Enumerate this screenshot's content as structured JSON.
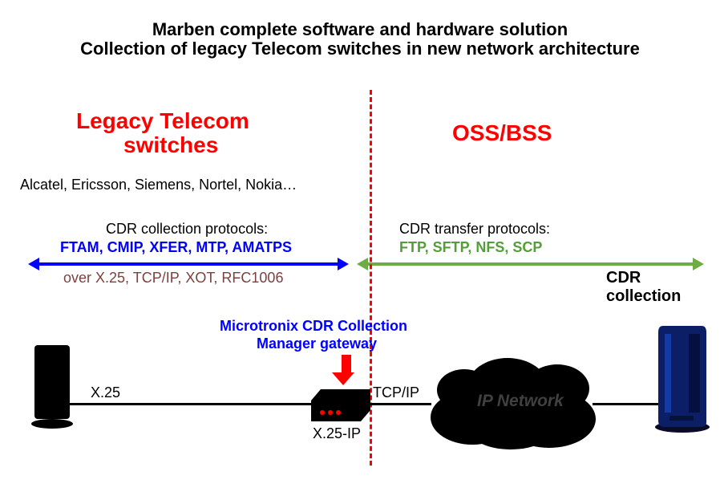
{
  "titles": {
    "line1": "Marben complete software and hardware solution",
    "line2": "Collection of legacy Telecom switches in new network architecture"
  },
  "left": {
    "header1": "Legacy Telecom",
    "header2": "switches",
    "vendors": "Alcatel, Ericsson, Siemens, Nortel, Nokia…",
    "collect_hdr": "CDR collection protocols:",
    "collect_proto": "FTAM, CMIP, XFER, MTP, AMATPS",
    "over": "over X.25, TCP/IP, XOT, RFC1006"
  },
  "right": {
    "header": "OSS/BSS",
    "transfer_hdr": "CDR transfer protocols:",
    "transfer_proto": "FTP, SFTP, NFS, SCP",
    "cdr_label1": "CDR",
    "cdr_label2": "collection"
  },
  "gateway": {
    "label1": "Microtronix CDR Collection",
    "label2": "Manager gateway",
    "caption": "X.25-IP"
  },
  "net": {
    "link1": "X.25",
    "link2": "TCP/IP",
    "cloud": "IP Network"
  },
  "icons": {
    "switch": "switch-icon",
    "gateway": "router-icon",
    "server": "server-icon",
    "cloud": "cloud-icon",
    "arrow_blue": "double-arrow-icon",
    "arrow_green": "double-arrow-icon",
    "arrow_red": "down-arrow-icon",
    "divider": "dashed-divider"
  },
  "colors": {
    "red": "#ff0000",
    "blue": "#0000ff",
    "green": "#6fac44",
    "brown": "#7f3f3f"
  }
}
